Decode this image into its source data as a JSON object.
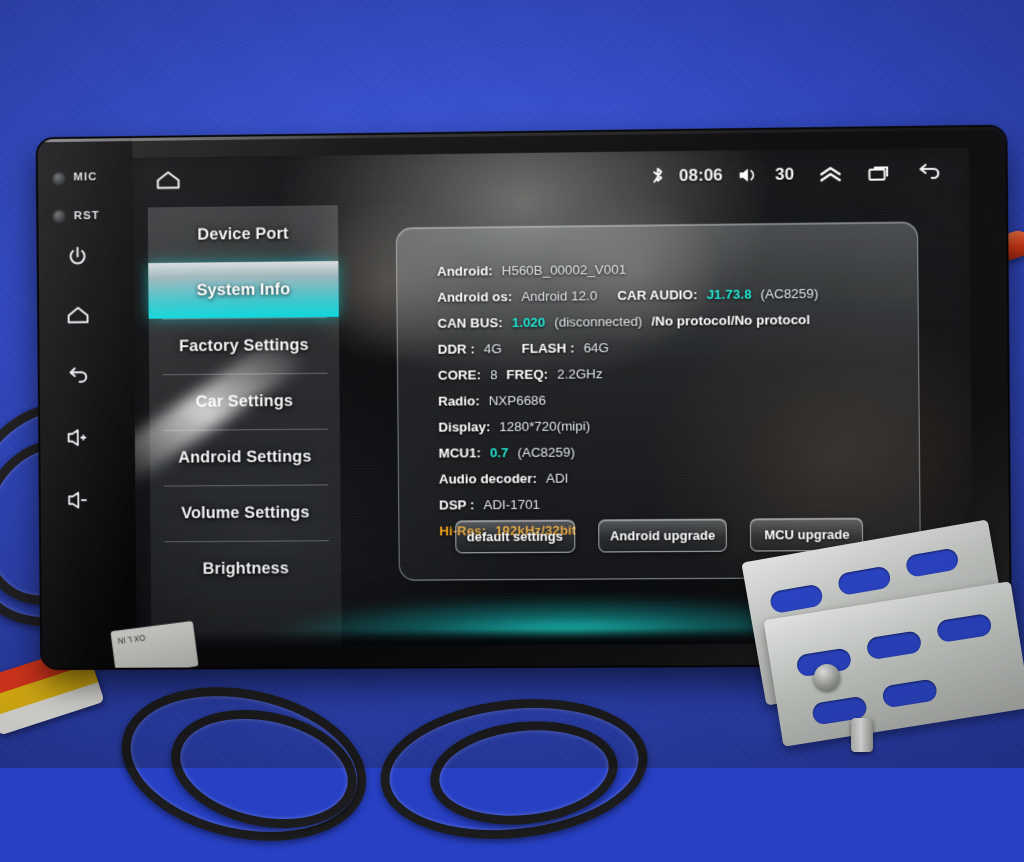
{
  "device": {
    "rail": {
      "mic_label": "MIC",
      "rst_label": "RST",
      "keys": [
        "power-icon",
        "home-icon",
        "back-icon",
        "volume-up-icon",
        "volume-down-icon"
      ]
    },
    "sticker_text": "OX L IN"
  },
  "statusbar": {
    "home_icon": "home-icon",
    "bluetooth_icon": "bluetooth-icon",
    "time": "08:06",
    "volume_icon": "volume-icon",
    "volume_level": "30",
    "expand_icon": "chevron-double-up-icon",
    "recents_icon": "recent-apps-icon",
    "back_icon": "back-arrow-icon"
  },
  "sidebar": {
    "items": [
      {
        "label": "Device Port",
        "active": false
      },
      {
        "label": "System Info",
        "active": true
      },
      {
        "label": "Factory Settings",
        "active": false
      },
      {
        "label": "Car Settings",
        "active": false
      },
      {
        "label": "Android Settings",
        "active": false
      },
      {
        "label": "Volume Settings",
        "active": false
      },
      {
        "label": "Brightness",
        "active": false
      }
    ]
  },
  "info": {
    "android_key": "Android:",
    "android_value": "H560B_00002_V001",
    "android_os_key": "Android os:",
    "android_os_value": "Android 12.0",
    "car_audio_key": "CAR AUDIO:",
    "car_audio_value": "J1.73.8",
    "car_audio_chip": "(AC8259)",
    "can_bus_key": "CAN BUS:",
    "can_bus_value": "1.020",
    "can_bus_state": "(disconnected)",
    "can_bus_protocol": "/No protocol/No protocol",
    "ddr_key": "DDR :",
    "ddr_value": "4G",
    "flash_key": "FLASH :",
    "flash_value": "64G",
    "core_key": "CORE:",
    "core_value": "8",
    "freq_key": "FREQ:",
    "freq_value": "2.2GHz",
    "radio_key": "Radio:",
    "radio_value": "NXP6686",
    "display_key": "Display:",
    "display_value": "1280*720(mipi)",
    "mcu1_key": "MCU1:",
    "mcu1_value": "0.7",
    "mcu1_chip": "(AC8259)",
    "audio_decoder_key": "Audio decoder:",
    "audio_decoder_value": "ADI",
    "dsp_key": "DSP :",
    "dsp_value": "ADI-1701",
    "hires_key": "Hi-Res:",
    "hires_value": "192kHz/32bit"
  },
  "buttons": {
    "default_settings": "default settings",
    "android_upgrade": "Android upgrade",
    "mcu_upgrade": "MCU upgrade"
  },
  "colors": {
    "accent_teal": "#0fd8dc",
    "value_cyan": "#24e8d4",
    "hires_amber": "#f5a623",
    "backdrop_blue": "#2a43c8"
  }
}
